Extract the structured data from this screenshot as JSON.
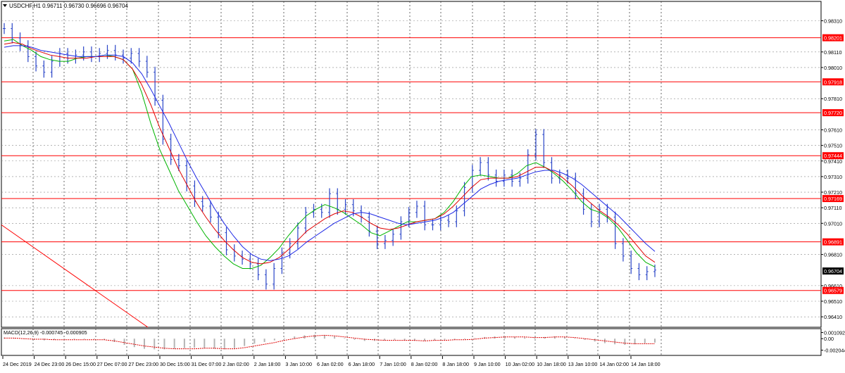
{
  "header": {
    "arrow_icon": "triangle-down-icon",
    "title": "USDCHF,H1  0.96711 0.96730 0.96696 0.96704"
  },
  "colors": {
    "candles": "#2a45c8",
    "ma_fast": "#00b400",
    "ma_mid": "#e00000",
    "ma_slow": "#1e28e6",
    "level_line": "#ff0000",
    "level_label_bg": "#ff0000",
    "current_label_bg": "#000000",
    "macd_hist": "#b4b4b4",
    "macd_signal": "#e00000",
    "grid": "#c8c8c8"
  },
  "chart_data": [
    {
      "type": "line",
      "title": "USDCHF,H1",
      "ohlc_last": {
        "open": 0.96711,
        "high": 0.9673,
        "low": 0.96696,
        "close": 0.96704
      },
      "x_tick_labels": [
        "24 Dec 2019",
        "24 Dec 23:00",
        "26 Dec 15:00",
        "27 Dec 07:00",
        "27 Dec 23:00",
        "30 Dec 15:00",
        "31 Dec 07:00",
        "2 Jan 02:00",
        "2 Jan 18:00",
        "3 Jan 10:00",
        "6 Jan 02:00",
        "6 Jan 18:00",
        "7 Jan 10:00",
        "8 Jan 02:00",
        "8 Jan 18:00",
        "9 Jan 10:00",
        "10 Jan 02:00",
        "10 Jan 18:00",
        "13 Jan 10:00",
        "14 Jan 02:00",
        "14 Jan 18:00"
      ],
      "y_tick_labels": [
        "0.98310",
        "0.98110",
        "0.98010",
        "0.97810",
        "0.97610",
        "0.97510",
        "0.97410",
        "0.97310",
        "0.97210",
        "0.97110",
        "0.97010",
        "0.96810",
        "0.96610",
        "0.96510",
        "0.96410"
      ],
      "ylim": [
        0.9637,
        0.9838
      ],
      "horizontal_levels": [
        "0.98201",
        "0.97918",
        "0.97720",
        "0.97444",
        "0.97169",
        "0.96891",
        "0.96579"
      ],
      "current_price": "0.96704",
      "series": [
        {
          "values": [
            0.9826,
            0.982,
            0.9815,
            0.9808,
            0.9802,
            0.9798,
            0.9805,
            0.981,
            0.9807,
            0.9809,
            0.9811,
            0.9808,
            0.981,
            0.9812,
            0.9809,
            0.9807,
            0.981,
            0.9805,
            0.9798,
            0.978,
            0.9755,
            0.9742,
            0.9738,
            0.9725,
            0.9715,
            0.9712,
            0.9705,
            0.9695,
            0.9684,
            0.968,
            0.9678,
            0.9675,
            0.9668,
            0.9662,
            0.9672,
            0.9682,
            0.9688,
            0.9698,
            0.9708,
            0.971,
            0.9708,
            0.972,
            0.971,
            0.9713,
            0.9709,
            0.9705,
            0.9696,
            0.9688,
            0.969,
            0.9694,
            0.9702,
            0.9708,
            0.9712,
            0.97,
            0.97,
            0.9703,
            0.9702,
            0.9709,
            0.9724,
            0.9735,
            0.974,
            0.9732,
            0.9728,
            0.9732,
            0.9728,
            0.973,
            0.9745,
            0.9758,
            0.974,
            0.973,
            0.9732,
            0.973,
            0.972,
            0.971,
            0.9702,
            0.971,
            0.9705,
            0.9688,
            0.968,
            0.9672,
            0.9668,
            0.967,
            0.9671
          ]
        },
        {
          "values": [
            0.9818,
            0.9819,
            0.9815,
            0.9812,
            0.9808,
            0.9806,
            0.9805,
            0.9805,
            0.9807,
            0.9808,
            0.9808,
            0.9809,
            0.9808,
            0.9806,
            0.98,
            0.9785,
            0.9765,
            0.9748,
            0.9735,
            0.9722,
            0.9712,
            0.9702,
            0.9693,
            0.9686,
            0.968,
            0.9675,
            0.9672,
            0.9672,
            0.9674,
            0.9679,
            0.9685,
            0.9693,
            0.97,
            0.9706,
            0.971,
            0.9713,
            0.9711,
            0.9708,
            0.9704,
            0.97,
            0.9695,
            0.9693,
            0.9696,
            0.9699,
            0.9702,
            0.9702,
            0.9703,
            0.9704,
            0.9708,
            0.9715,
            0.9724,
            0.9731,
            0.9732,
            0.9731,
            0.973,
            0.973,
            0.9733,
            0.9738,
            0.974,
            0.9737,
            0.9733,
            0.9728,
            0.9722,
            0.9715,
            0.971,
            0.9708,
            0.9704,
            0.9698,
            0.969,
            0.9682,
            0.9676,
            0.9673
          ]
        },
        {
          "values": [
            0.9816,
            0.9817,
            0.9816,
            0.9813,
            0.9811,
            0.9809,
            0.9808,
            0.9807,
            0.9807,
            0.9807,
            0.9808,
            0.9808,
            0.9808,
            0.9806,
            0.98,
            0.979,
            0.9777,
            0.9762,
            0.9749,
            0.9736,
            0.9725,
            0.9714,
            0.9705,
            0.9697,
            0.969,
            0.9684,
            0.9679,
            0.9676,
            0.9675,
            0.9676,
            0.9679,
            0.9684,
            0.969,
            0.9696,
            0.97,
            0.9704,
            0.9707,
            0.9709,
            0.9708,
            0.9705,
            0.9701,
            0.9698,
            0.9697,
            0.9698,
            0.97,
            0.9702,
            0.9703,
            0.9704,
            0.9707,
            0.9712,
            0.9718,
            0.9724,
            0.9729,
            0.973,
            0.973,
            0.973,
            0.9731,
            0.9734,
            0.9737,
            0.9737,
            0.9734,
            0.973,
            0.9725,
            0.9719,
            0.9714,
            0.9709,
            0.9705,
            0.97,
            0.9694,
            0.9687,
            0.968,
            0.9676
          ]
        },
        {
          "values": [
            0.9814,
            0.9815,
            0.9815,
            0.9814,
            0.9812,
            0.9811,
            0.981,
            0.9809,
            0.9808,
            0.9808,
            0.9808,
            0.9809,
            0.9809,
            0.9808,
            0.9804,
            0.9797,
            0.9787,
            0.9776,
            0.9765,
            0.9753,
            0.9741,
            0.973,
            0.972,
            0.971,
            0.9701,
            0.9693,
            0.9686,
            0.9681,
            0.9678,
            0.9677,
            0.9678,
            0.968,
            0.9684,
            0.9689,
            0.9693,
            0.9697,
            0.9701,
            0.9704,
            0.9707,
            0.9708,
            0.9707,
            0.9705,
            0.9703,
            0.9701,
            0.97,
            0.9701,
            0.9702,
            0.9703,
            0.9705,
            0.9708,
            0.9713,
            0.9718,
            0.9723,
            0.9726,
            0.9728,
            0.9729,
            0.973,
            0.9732,
            0.9734,
            0.9735,
            0.9735,
            0.9733,
            0.973,
            0.9726,
            0.9721,
            0.9716,
            0.9711,
            0.9706,
            0.97,
            0.9694,
            0.9688,
            0.9683
          ]
        }
      ]
    },
    {
      "type": "area",
      "title": "MACD(12,26,9) -0.000745 -0.000905",
      "y_tick_labels": [
        "0.001092",
        "0.00",
        "-0.002044"
      ],
      "ylim": [
        -0.0026,
        0.0014
      ],
      "series": [
        {
          "values": [
            0.0002,
            0.0001,
            -0.0001,
            -0.0002,
            -0.0003,
            -0.0002,
            -0.0002,
            -0.0001,
            -0.0001,
            -0.0001,
            -0.0002,
            -0.0006,
            -0.0011,
            -0.0015,
            -0.0018,
            -0.0019,
            -0.0019,
            -0.0018,
            -0.0017,
            -0.0016,
            -0.0017,
            -0.0018,
            -0.0019,
            -0.0017,
            -0.0013,
            -0.0009,
            -0.0006,
            -0.0003,
            0.0001,
            0.0004,
            0.0006,
            0.0007,
            0.0006,
            0.0004,
            0.0001,
            -0.0002,
            -0.0004,
            -0.0004,
            -0.0003,
            -0.0002,
            -0.0003,
            -0.0004,
            -0.0004,
            -0.0003,
            -0.0002,
            -0.0002,
            -0.0001,
            0.0001,
            0.0003,
            0.0004,
            0.0004,
            0.0003,
            0.0002,
            0.0002,
            0.0003,
            0.0004,
            0.0003,
            0.0001,
            -0.0002,
            -0.0005,
            -0.0008,
            -0.001,
            -0.0011,
            -0.001,
            -0.0008,
            -0.0007
          ]
        },
        {
          "values": [
            0.0001,
            0.0001,
            0,
            -0.0001,
            -0.0001,
            -0.0002,
            -0.0002,
            -0.0002,
            -0.0002,
            -0.0002,
            -0.0002,
            -0.0004,
            -0.0007,
            -0.001,
            -0.0013,
            -0.0015,
            -0.0017,
            -0.0018,
            -0.0018,
            -0.0018,
            -0.0017,
            -0.0017,
            -0.0018,
            -0.0018,
            -0.0016,
            -0.0013,
            -0.001,
            -0.0007,
            -0.0003,
            0,
            0.0003,
            0.0005,
            0.0006,
            0.0005,
            0.0003,
            0.0001,
            -0.0001,
            -0.0002,
            -0.0003,
            -0.0003,
            -0.0003,
            -0.0003,
            -0.0004,
            -0.0003,
            -0.0003,
            -0.0002,
            -0.0002,
            -0.0001,
            0.0001,
            0.0002,
            0.0003,
            0.0003,
            0.0003,
            0.0002,
            0.0002,
            0.0003,
            0.0003,
            0.0002,
            0,
            -0.0002,
            -0.0004,
            -0.0006,
            -0.0008,
            -0.0009,
            -0.0009,
            -0.0009
          ]
        }
      ]
    }
  ]
}
